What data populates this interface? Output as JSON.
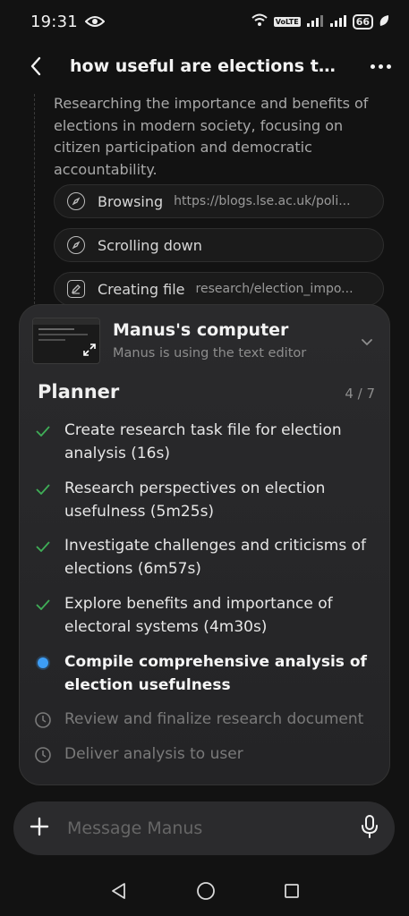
{
  "status": {
    "time": "19:31",
    "network": "7",
    "volte": "VoLTE",
    "sim2": "1|2",
    "battery": "66"
  },
  "header": {
    "title": "how useful are elections tod..."
  },
  "timeline": {
    "description": "Researching the importance and benefits of elections in modern society, focusing on citizen participation and democratic accountability.",
    "actions": [
      {
        "label": "Browsing",
        "arg": "https://blogs.lse.ac.uk/poli...",
        "icon": "compass-icon"
      },
      {
        "label": "Scrolling down",
        "arg": "",
        "icon": "compass-icon"
      },
      {
        "label": "Creating file",
        "arg": "research/election_impo...",
        "icon": "edit-file-icon"
      }
    ]
  },
  "computer": {
    "title": "Manus's computer",
    "subtitle": "Manus is using the text editor"
  },
  "planner": {
    "title": "Planner",
    "count": "4 / 7",
    "tasks": [
      {
        "text": "Create research task file for election analysis (16s)",
        "status": "done"
      },
      {
        "text": "Research perspectives on election usefulness (5m25s)",
        "status": "done"
      },
      {
        "text": "Investigate challenges and criticisms of elections (6m57s)",
        "status": "done"
      },
      {
        "text": "Explore benefits and importance of electoral systems (4m30s)",
        "status": "done"
      },
      {
        "text": "Compile comprehensive analysis of election usefulness",
        "status": "active"
      },
      {
        "text": "Review and finalize research document",
        "status": "pending"
      },
      {
        "text": "Deliver analysis to user",
        "status": "pending"
      }
    ]
  },
  "message": {
    "placeholder": "Message Manus"
  },
  "colors": {
    "check": "#3fae57",
    "active_dot": "#3d9df5",
    "background": "#121212"
  }
}
